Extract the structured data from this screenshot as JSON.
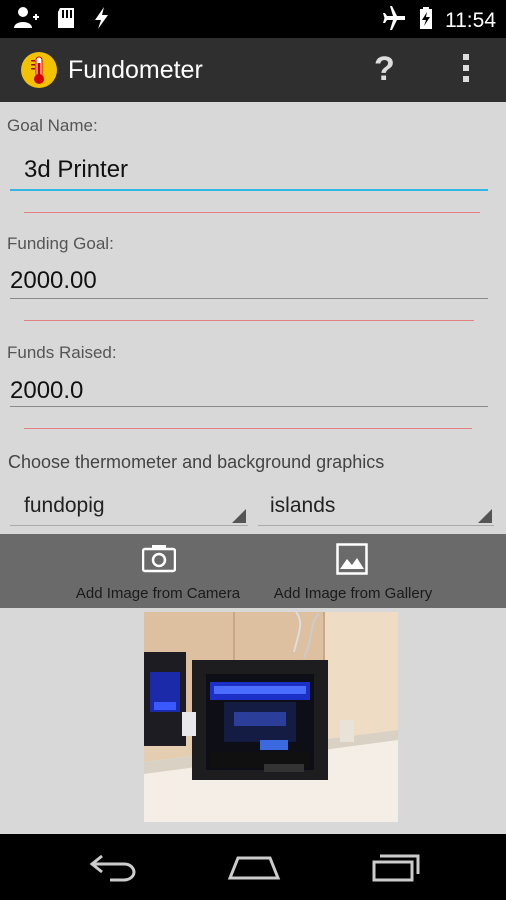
{
  "status_bar": {
    "time": "11:54",
    "icons": [
      "person-add-icon",
      "sd-card-icon",
      "bolt-icon",
      "airplane-icon",
      "battery-charging-icon"
    ]
  },
  "action_bar": {
    "title": "Fundometer",
    "logo_icon": "thermometer-logo-icon",
    "help_label": "?",
    "overflow_icon": "overflow-menu-icon"
  },
  "form": {
    "goal_name_label": "Goal Name:",
    "goal_name_value": "3d Printer",
    "funding_goal_label": "Funding Goal:",
    "funding_goal_value": "2000.00",
    "funds_raised_label": "Funds Raised:",
    "funds_raised_value": "2000.0",
    "graphics_label": "Choose thermometer and background graphics",
    "thermometer_choice": "fundopig",
    "background_choice": "islands"
  },
  "image_bar": {
    "camera_label": "Add Image from Camera",
    "gallery_label": "Add Image from Gallery"
  },
  "photo": {
    "subject": "3d-printer-photo"
  },
  "nav_bar": {
    "icons": [
      "back-icon",
      "home-icon",
      "recent-apps-icon"
    ]
  },
  "colors": {
    "accent": "#33b5e5",
    "error_line": "#e08080",
    "action_bar": "#2f2f2f",
    "content_bg": "#d8d8d8"
  }
}
